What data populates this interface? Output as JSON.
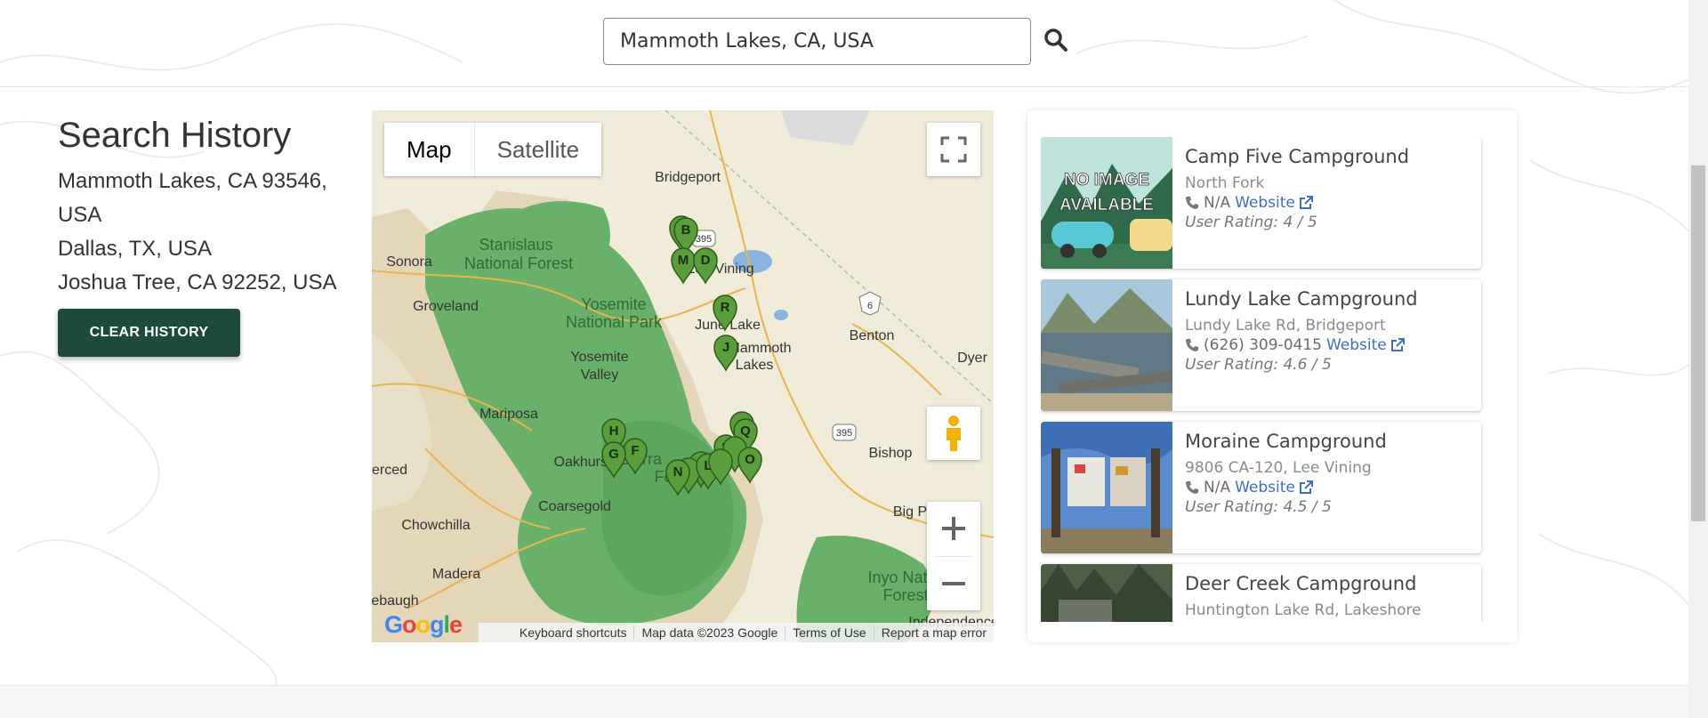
{
  "search": {
    "value": "Mammoth Lakes, CA, USA",
    "button_icon": "search-icon"
  },
  "history": {
    "title": "Search History",
    "items": [
      "Mammoth Lakes, CA 93546, USA",
      "Dallas, TX, USA",
      "Joshua Tree, CA 92252, USA"
    ],
    "clear_label": "CLEAR HISTORY"
  },
  "map": {
    "type_options": [
      "Map",
      "Satellite"
    ],
    "selected_type": "Map",
    "places": [
      "Bridgeport",
      "Stanislaus",
      "National Forest",
      "Sonora",
      "Lee Vining",
      "Groveland",
      "Yosemite",
      "National Park",
      "June Lake",
      "Mammoth",
      "Lakes",
      "Benton",
      "Dyer",
      "Yosemite",
      "Valley",
      "Mariposa",
      "Oakhurst",
      "Sierra",
      "Forest",
      "Bishop",
      "erced",
      "Coarsegold",
      "Chowchilla",
      "Big P",
      "Madera",
      "Inyo Natio",
      "Forest",
      "ebaugh",
      "Independence",
      "395",
      "6",
      "395"
    ],
    "markers": [
      "B",
      "M",
      "D",
      "R",
      "J",
      "H",
      "F",
      "G",
      "N",
      "L",
      "S",
      "Q",
      "O"
    ],
    "footer": [
      "Keyboard shortcuts",
      "Map data ©2023 Google",
      "Terms of Use",
      "Report a map error"
    ],
    "logo": "Google",
    "icons": {
      "fullscreen": "fullscreen-icon",
      "pegman": "pegman-icon",
      "zoom_in": "plus-icon",
      "zoom_out": "minus-icon"
    }
  },
  "results": [
    {
      "name": "Camp Five Campground",
      "address": "North Fork",
      "phone": "N/A",
      "website": "Website",
      "rating": "User Rating: 4 / 5",
      "image_text": [
        "NO IMAGE",
        "AVAILABLE"
      ]
    },
    {
      "name": "Lundy Lake Campground",
      "address": "Lundy Lake Rd, Bridgeport",
      "phone": "(626) 309-0415",
      "website": "Website",
      "rating": "User Rating: 4.6 / 5"
    },
    {
      "name": "Moraine Campground",
      "address": "9806 CA-120, Lee Vining",
      "phone": "N/A",
      "website": "Website",
      "rating": "User Rating: 4.5 / 5"
    },
    {
      "name": "Deer Creek Campground",
      "address": "Huntington Lake Rd, Lakeshore"
    }
  ],
  "colors": {
    "primary": "#1e4a3a",
    "link": "#3a6ccf",
    "map_green": "#69b06a",
    "marker": "#5a9e3c"
  }
}
